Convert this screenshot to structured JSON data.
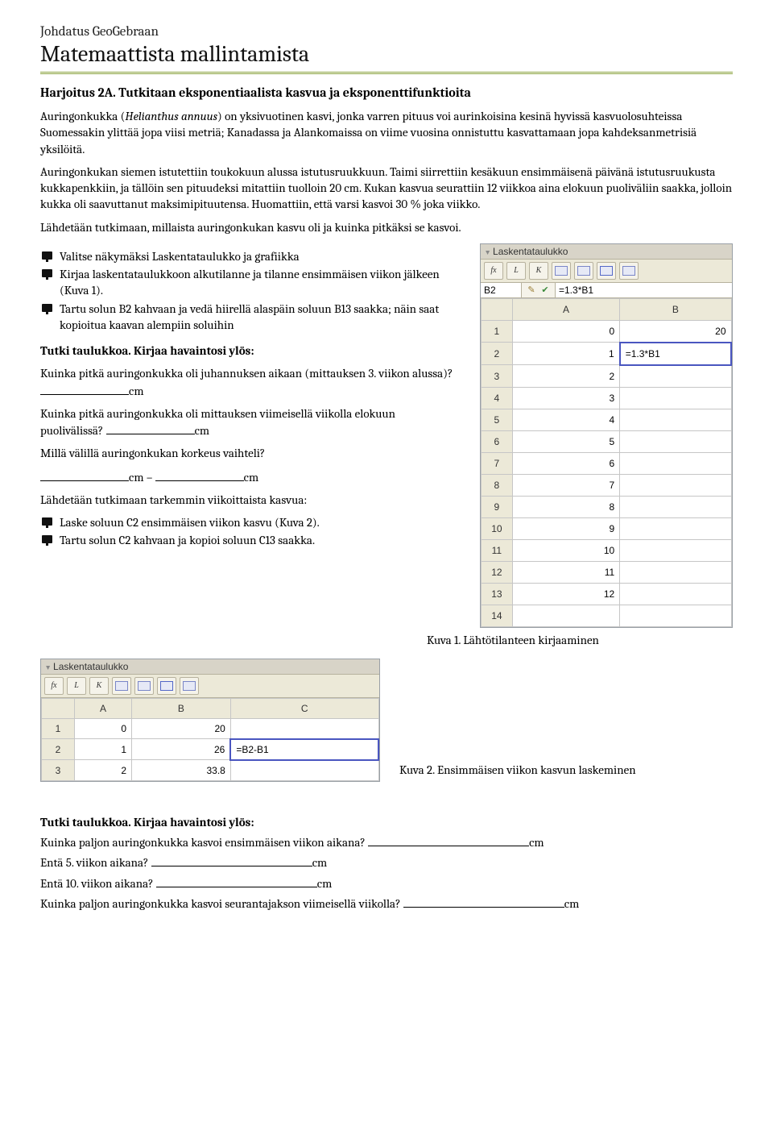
{
  "header": {
    "small": "Johdatus GeoGebraan",
    "large": "Matemaattista mallintamista"
  },
  "exercise": {
    "title": "Harjoitus 2A. Tutkitaan eksponentiaalista kasvua ja eksponenttifunktioita",
    "p1a": "Auringonkukka (",
    "p1_species": "Helianthus annuus",
    "p1b": ") on yksivuotinen kasvi, jonka varren pituus voi aurinkoisina kesinä hyvissä kasvuolosuhteissa Suomessakin ylittää jopa viisi metriä; Kanadassa ja Alankomaissa on viime vuosina onnistuttu kasvattamaan jopa kahdeksanmetrisiä yksilöitä.",
    "p2": "Auringonkukan siemen istutettiin toukokuun alussa istutusruukkuun. Taimi siirrettiin kesäkuun ensimmäisenä päivänä istutusruukusta kukkapenkkiin, ja tällöin sen pituudeksi mitattiin tuolloin 20 cm. Kukan kasvua seurattiin 12 viikkoa aina elokuun puoliväliin saakka, jolloin kukka oli saavuttanut maksimipituutensa. Huomattiin, että varsi kasvoi 30 % joka viikko.",
    "p3": "Lähdetään tutkimaan, millaista auringonkukan kasvu oli ja kuinka pitkäksi se kasvoi.",
    "list1": [
      "Valitse näkymäksi Laskentataulukko ja grafiikka",
      "Kirjaa laskentataulukkoon alkutilanne ja tilanne ensimmäisen viikon jälkeen (Kuva 1).",
      "Tartu solun B2 kahvaan ja vedä hiirellä alaspäin soluun B13 saakka; näin saat kopioitua kaavan alempiin soluihin"
    ],
    "tutki_title": "Tutki taulukkoa. Kirjaa havaintosi ylös:",
    "q1": "Kuinka pitkä auringonkukka oli juhannuksen aikaan (mittauksen 3. viikon alussa)?",
    "q2": "Kuinka pitkä auringonkukka oli mittauksen viimeisellä viikolla elokuun puolivälissä?",
    "q3": "Millä välillä auringonkukan korkeus vaihteli?",
    "cm": "cm",
    "dash": " – ",
    "p4": "Lähdetään tutkimaan tarkemmin viikoittaista kasvua:",
    "list2": [
      "Laske soluun C2 ensimmäisen viikon kasvu (Kuva 2).",
      "Tartu solun C2 kahvaan ja kopioi soluun C13 saakka."
    ],
    "caption1": "Kuva 1. Lähtötilanteen kirjaaminen",
    "caption2": "Kuva 2. Ensimmäisen viikon kasvun laskeminen",
    "foot_q1": "Kuinka paljon auringonkukka kasvoi ensimmäisen viikon aikana?",
    "foot_q2": "Entä  5. viikon aikana?",
    "foot_q3": "Entä 10. viikon aikana?",
    "foot_q4": "Kuinka paljon auringonkukka kasvoi seurantajakson viimeisellä viikolla?"
  },
  "ss1": {
    "title": "Laskentataulukko",
    "toolbar": [
      "fx",
      "L",
      "K"
    ],
    "cellref": "B2",
    "formula": "=1.3*B1",
    "cols": [
      "",
      "A",
      "B"
    ],
    "rows": [
      {
        "n": "1",
        "a": "0",
        "b": "20",
        "edit": false
      },
      {
        "n": "2",
        "a": "1",
        "b": "=1.3*B1",
        "edit": true
      },
      {
        "n": "3",
        "a": "2",
        "b": "",
        "edit": false
      },
      {
        "n": "4",
        "a": "3",
        "b": "",
        "edit": false
      },
      {
        "n": "5",
        "a": "4",
        "b": "",
        "edit": false
      },
      {
        "n": "6",
        "a": "5",
        "b": "",
        "edit": false
      },
      {
        "n": "7",
        "a": "6",
        "b": "",
        "edit": false
      },
      {
        "n": "8",
        "a": "7",
        "b": "",
        "edit": false
      },
      {
        "n": "9",
        "a": "8",
        "b": "",
        "edit": false
      },
      {
        "n": "10",
        "a": "9",
        "b": "",
        "edit": false
      },
      {
        "n": "11",
        "a": "10",
        "b": "",
        "edit": false
      },
      {
        "n": "12",
        "a": "11",
        "b": "",
        "edit": false
      },
      {
        "n": "13",
        "a": "12",
        "b": "",
        "edit": false
      },
      {
        "n": "14",
        "a": "",
        "b": "",
        "edit": false
      }
    ]
  },
  "ss2": {
    "title": "Laskentataulukko",
    "toolbar": [
      "fx",
      "L",
      "K"
    ],
    "cols": [
      "",
      "A",
      "B",
      "C"
    ],
    "rows": [
      {
        "n": "1",
        "a": "0",
        "b": "20",
        "c": "",
        "edit": false
      },
      {
        "n": "2",
        "a": "1",
        "b": "26",
        "c": "=B2-B1",
        "edit": true
      },
      {
        "n": "3",
        "a": "2",
        "b": "33.8",
        "c": "",
        "edit": false
      }
    ]
  }
}
